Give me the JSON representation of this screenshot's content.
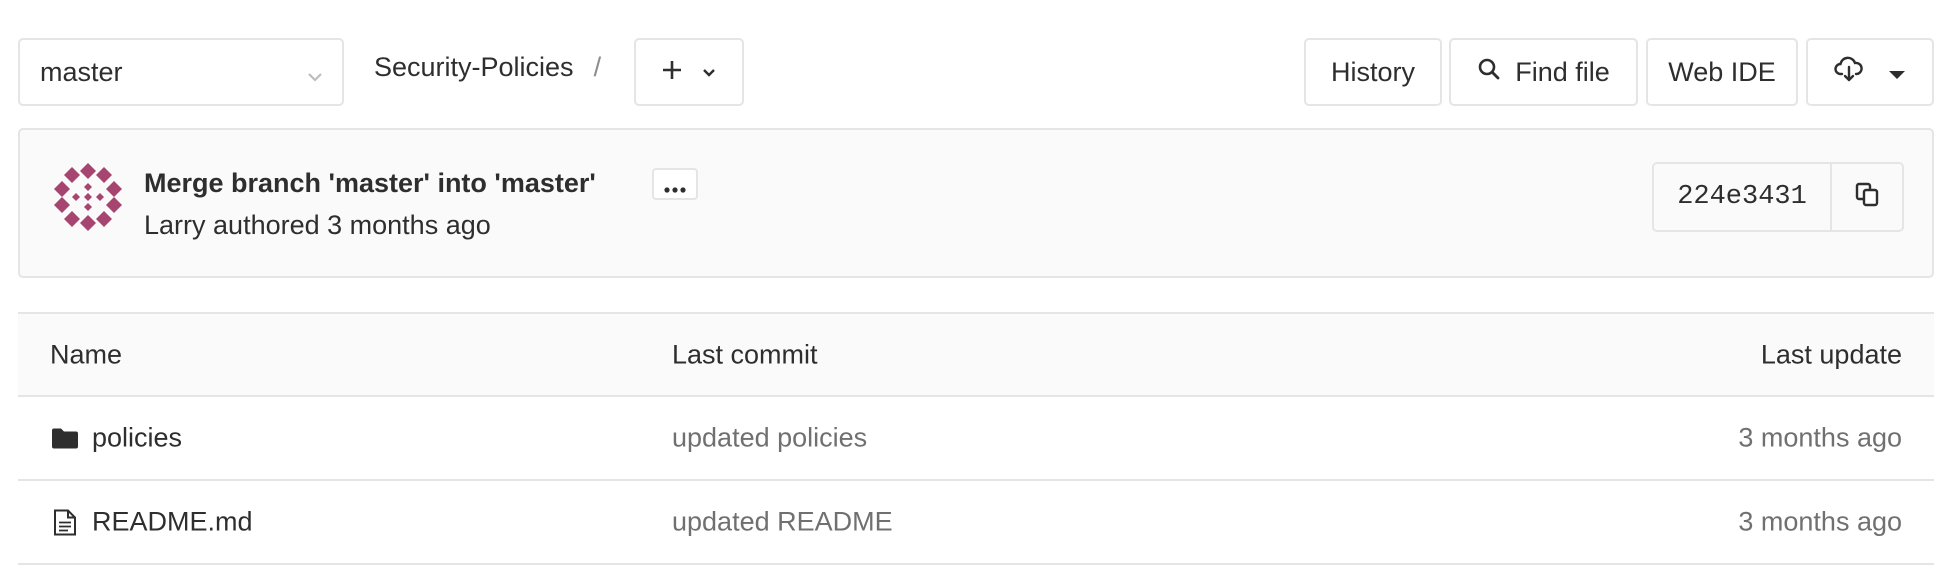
{
  "toolbar": {
    "branch": "master",
    "breadcrumb": "Security-Policies",
    "breadcrumb_separator": "/",
    "add_label": "+",
    "history_label": "History",
    "find_file_label": "Find file",
    "web_ide_label": "Web IDE"
  },
  "commit": {
    "title": "Merge branch 'master' into 'master'",
    "more_label": "•••",
    "author": "Larry",
    "authored_text": "authored",
    "time_ago": "3 months ago",
    "sha": "224e3431",
    "avatar_color": "#a6456f"
  },
  "table": {
    "headers": {
      "name": "Name",
      "last_commit": "Last commit",
      "last_update": "Last update"
    },
    "rows": [
      {
        "icon": "folder-icon",
        "name": "policies",
        "last_commit": "updated policies",
        "last_update": "3 months ago"
      },
      {
        "icon": "file-icon",
        "name": "README.md",
        "last_commit": "updated README",
        "last_update": "3 months ago"
      }
    ]
  },
  "colors": {
    "border": "#e5e5e5",
    "text": "#2e2e2e",
    "muted": "#707070",
    "header_bg": "#fafafa"
  }
}
